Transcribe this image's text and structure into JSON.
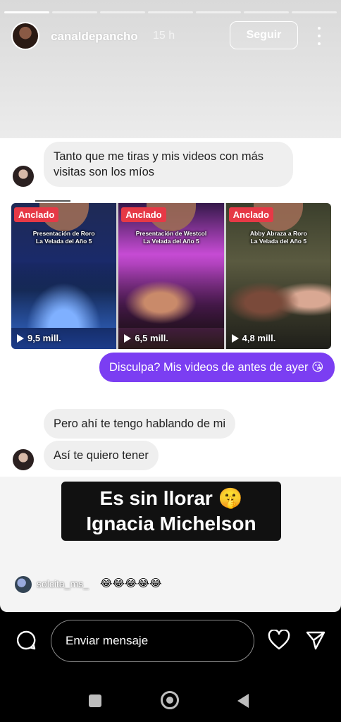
{
  "story": {
    "username": "canaldepancho",
    "time_ago": "15 h",
    "follow_label": "Seguir",
    "progress_segments": 7,
    "progress_done": 1
  },
  "chat": {
    "incoming_1": "Tanto que me tiras y mis videos con más visitas son los míos",
    "reels": [
      {
        "badge": "Anclado",
        "title_line1": "Presentación de Roro",
        "title_line2": "La Velada del Año 5",
        "views": "9,5 mill."
      },
      {
        "badge": "Anclado",
        "title_line1": "Presentación de Westcol",
        "title_line2": "La Velada del Año 5",
        "views": "6,5 mill."
      },
      {
        "badge": "Anclado",
        "title_line1": "Abby Abraza a Roro",
        "title_line2": "La Velada del Año 5",
        "views": "4,8 mill."
      }
    ],
    "outgoing_1": "Disculpa? Mis videos de antes de ayer 😘",
    "incoming_2": "Pero ahí te tengo hablando de mi",
    "incoming_3": "Así te quiero tener"
  },
  "caption": {
    "line1": "Es sin llorar 🤫",
    "line2": "Ignacia Michelson"
  },
  "reaction": {
    "user": "solcita_ms_",
    "emojis": "😂😂😂😂😂"
  },
  "footer": {
    "message_placeholder": "Enviar mensaje"
  }
}
